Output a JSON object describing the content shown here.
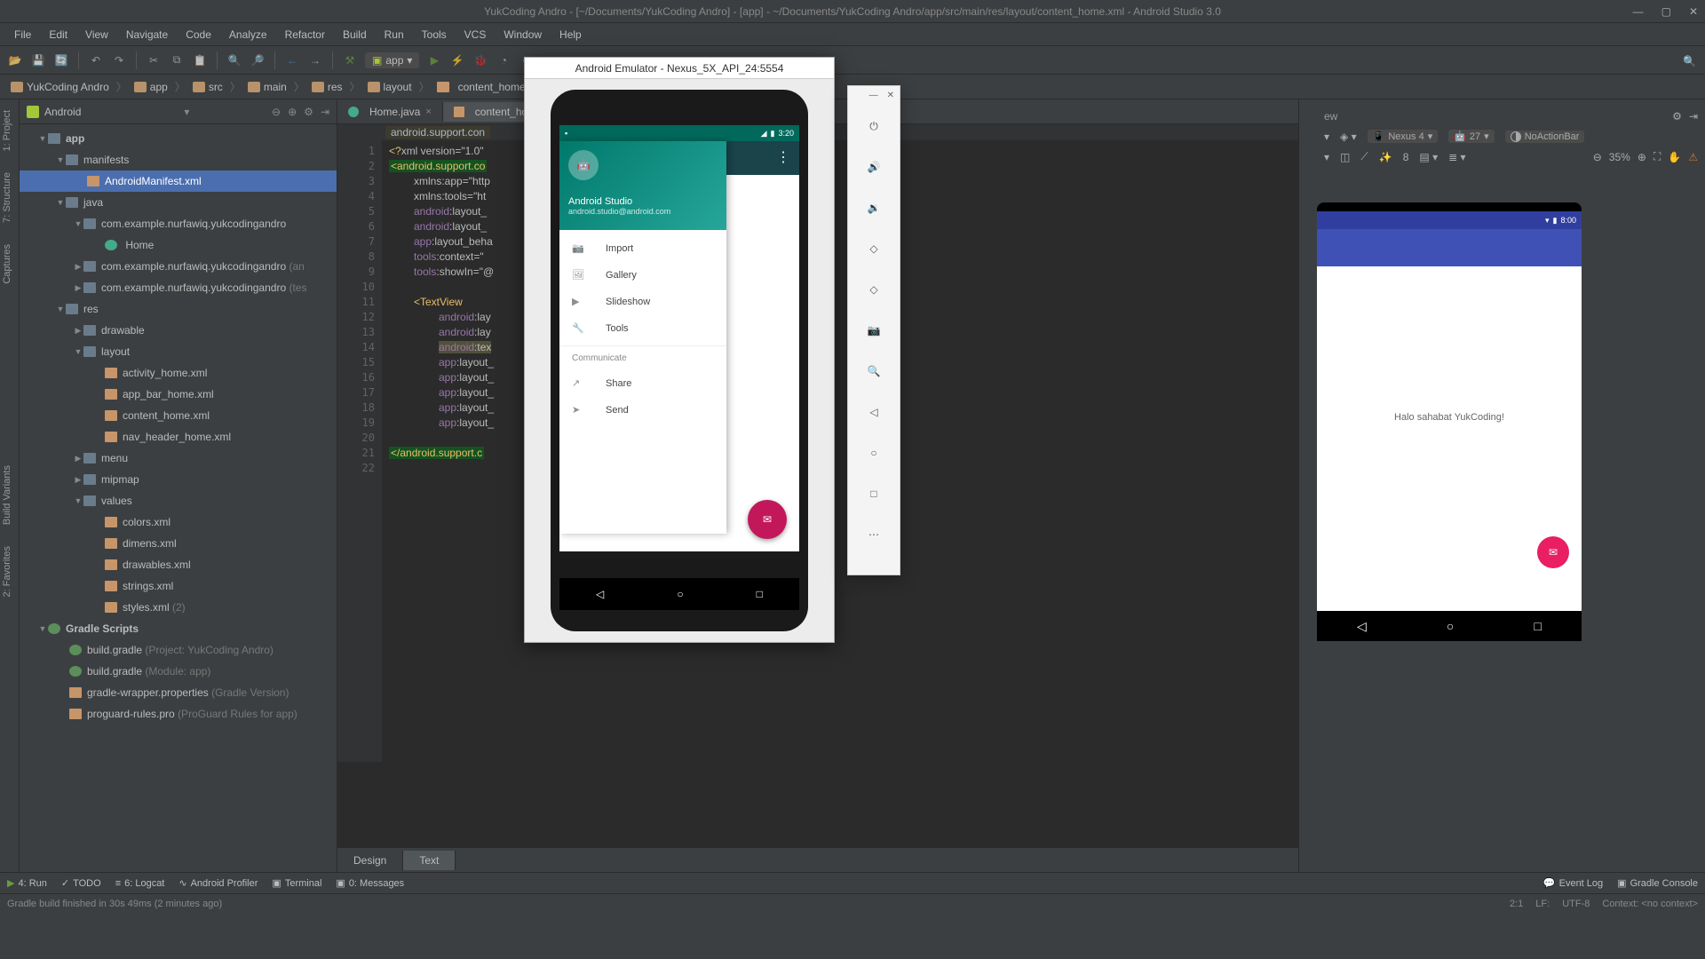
{
  "window": {
    "title": "YukCoding Andro - [~/Documents/YukCoding Andro] - [app] - ~/Documents/YukCoding Andro/app/src/main/res/layout/content_home.xml - Android Studio 3.0"
  },
  "menu": [
    "File",
    "Edit",
    "View",
    "Navigate",
    "Code",
    "Analyze",
    "Refactor",
    "Build",
    "Run",
    "Tools",
    "VCS",
    "Window",
    "Help"
  ],
  "toolbar": {
    "run_config": "app"
  },
  "breadcrumb": [
    "YukCoding Andro",
    "app",
    "src",
    "main",
    "res",
    "layout",
    "content_home.xml"
  ],
  "project": {
    "view_mode": "Android",
    "tree": {
      "app": "app",
      "manifests": "manifests",
      "manifest_file": "AndroidManifest.xml",
      "java": "java",
      "pkg1": "com.example.nurfawiq.yukcodingandro",
      "home_class": "Home",
      "pkg2": "com.example.nurfawiq.yukcodingandro",
      "pkg2_suffix": "(an",
      "pkg3": "com.example.nurfawiq.yukcodingandro",
      "pkg3_suffix": "(tes",
      "res": "res",
      "drawable": "drawable",
      "layout": "layout",
      "layout_files": [
        "activity_home.xml",
        "app_bar_home.xml",
        "content_home.xml",
        "nav_header_home.xml"
      ],
      "menu_dir": "menu",
      "mipmap": "mipmap",
      "values": "values",
      "values_files": [
        "colors.xml",
        "dimens.xml",
        "drawables.xml",
        "strings.xml"
      ],
      "styles": "styles.xml",
      "styles_count": "(2)",
      "gradle_scripts": "Gradle Scripts",
      "build_gradle": "build.gradle",
      "bg_project": "(Project: YukCoding Andro)",
      "bg_module": "(Module: app)",
      "wrapper": "gradle-wrapper.properties",
      "wrapper_note": "(Gradle Version)",
      "proguard": "proguard-rules.pro",
      "proguard_note": "(ProGuard Rules for app)"
    }
  },
  "left_sidebar_tabs": [
    "1: Project",
    "7: Structure",
    "Captures",
    "Build Variants",
    "2: Favorites"
  ],
  "editor": {
    "tabs": [
      {
        "name": "Home.java"
      },
      {
        "name": "content_ho"
      }
    ],
    "helper": "android.support.con",
    "lines": {
      "l1a": "<?",
      "l1b": "xml version=\"1.0\"",
      "l2": "<android.support.co",
      "l3": "xmlns:app=\"http",
      "l4": "xmlns:tools=\"ht",
      "l5a": "android",
      "l5b": ":layout_",
      "l6a": "android",
      "l6b": ":layout_",
      "l7a": "app",
      "l7b": ":layout_beha",
      "l8a": "tools",
      "l8b": ":context=\"",
      "l9a": "tools",
      "l9b": ":showIn=\"@",
      "l11": "<TextView",
      "l12a": "android",
      "l12b": ":lay",
      "l13a": "android",
      "l13b": ":lay",
      "l14a": "android",
      "l14b": ":tex",
      "l15a": "app",
      "l15b": ":layout_",
      "l16a": "app",
      "l16b": ":layout_",
      "l17a": "app",
      "l17b": ":layout_",
      "l18a": "app",
      "l18b": ":layout_",
      "l19a": "app",
      "l19b": ":layout_",
      "l21": "</android.support.c"
    },
    "bottom_tabs": [
      "Design",
      "Text"
    ]
  },
  "design": {
    "device": "Nexus 4",
    "api": "27",
    "theme": "NoActionBar",
    "pixel_density": "8",
    "zoom": "35%",
    "preview": {
      "time": "8:00",
      "content_text": "Halo sahabat YukCoding!"
    }
  },
  "emulator": {
    "title": "Android Emulator - Nexus_5X_API_24:5554",
    "status_time": "3:20",
    "drawer": {
      "name": "Android Studio",
      "email": "android.studio@android.com",
      "items": [
        "Import",
        "Gallery",
        "Slideshow",
        "Tools"
      ],
      "section": "Communicate",
      "items2": [
        "Share",
        "Send"
      ]
    }
  },
  "statusbar": {
    "run": "4: Run",
    "todo": "TODO",
    "logcat": "6: Logcat",
    "profiler": "Android Profiler",
    "terminal": "Terminal",
    "messages": "0: Messages",
    "event_log": "Event Log",
    "gradle_console": "Gradle Console"
  },
  "bottom": {
    "build_msg": "Gradle build finished in 30s 49ms (2 minutes ago)",
    "cursor": "2:1",
    "line_sep": "LF:",
    "encoding": "UTF-8",
    "context": "Context: <no context>"
  }
}
